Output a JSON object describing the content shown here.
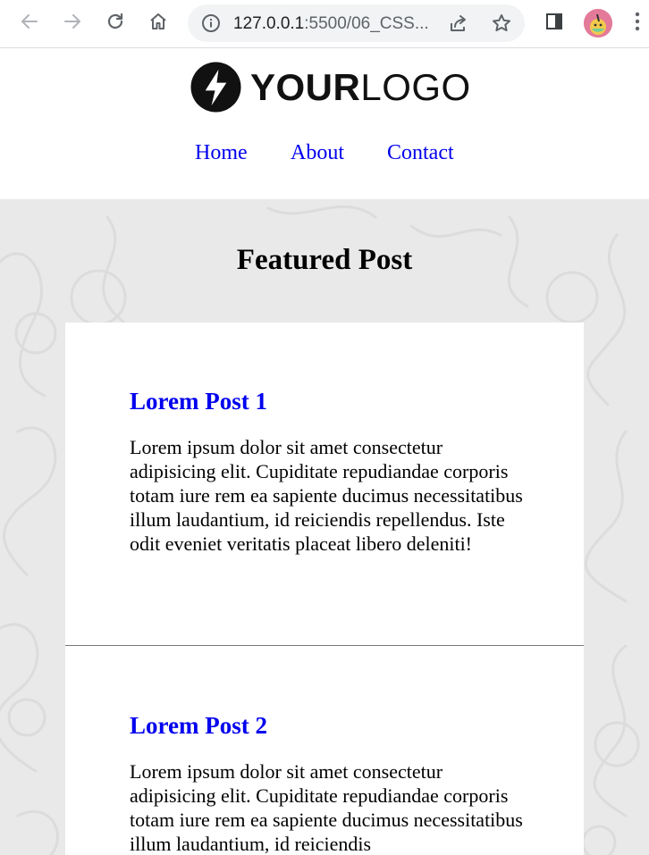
{
  "browser": {
    "url_host": "127.0.0.1",
    "url_rest": ":5500/06_CSS..."
  },
  "header": {
    "logo_bold": "YOUR",
    "logo_light": "LOGO",
    "nav": [
      "Home",
      "About",
      "Contact"
    ]
  },
  "main": {
    "section_title": "Featured Post",
    "posts": [
      {
        "title": "Lorem Post 1",
        "body": "Lorem ipsum dolor sit amet consectetur adipisicing elit. Cupiditate repudiandae corporis totam iure rem ea sapiente ducimus necessitatibus illum laudantium, id reiciendis repellendus. Iste odit eveniet veritatis placeat libero deleniti!"
      },
      {
        "title": "Lorem Post 2",
        "body": "Lorem ipsum dolor sit amet consectetur adipisicing elit. Cupiditate repudiandae corporis totam iure rem ea sapiente ducimus necessitatibus illum laudantium, id reiciendis"
      }
    ]
  },
  "colors": {
    "link": "#0000ee",
    "page_background": "#e9e9e9",
    "card": "#ffffff"
  },
  "icons": [
    "back-arrow-icon",
    "forward-arrow-icon",
    "reload-icon",
    "home-icon",
    "info-icon",
    "share-icon",
    "star-icon",
    "sidebar-icon",
    "kebab-menu-icon",
    "lightning-bolt-icon"
  ]
}
